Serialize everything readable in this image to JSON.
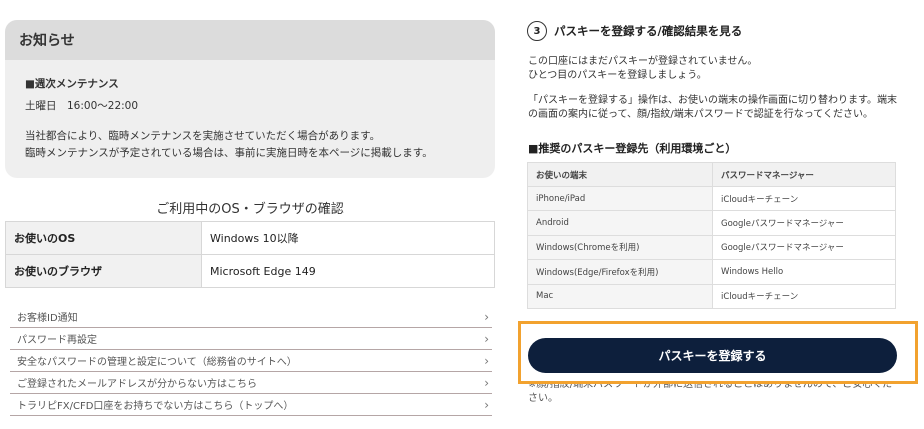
{
  "notice": {
    "heading": "お知らせ",
    "title": "■週次メンテナンス",
    "time": "土曜日　16:00～22:00",
    "line1": "当社都合により、臨時メンテナンスを実施させていただく場合があります。",
    "line2": "臨時メンテナンスが予定されている場合は、事前に実施日時を本ページに掲載します。"
  },
  "environment": {
    "title": "ご利用中のOS・ブラウザの確認",
    "rows": [
      {
        "label": "お使いのOS",
        "value": "Windows 10以降"
      },
      {
        "label": "お使いのブラウザ",
        "value": "Microsoft Edge 149"
      }
    ]
  },
  "links": [
    {
      "label": "お客様ID通知",
      "chevron": "›"
    },
    {
      "label": "パスワード再設定",
      "chevron": "›"
    },
    {
      "label": "安全なパスワードの管理と設定について（総務省のサイトへ）",
      "chevron": "›"
    },
    {
      "label": "ご登録されたメールアドレスが分からない方はこちら",
      "chevron": "›"
    },
    {
      "label": "トラリピFX/CFD口座をお持ちでない方はこちら（トップへ）",
      "chevron": "›"
    }
  ],
  "step": {
    "number": "3",
    "title": "パスキーを登録する/確認結果を見る"
  },
  "paragraphs": {
    "p1_line1": "この口座にはまだパスキーが登録されていません。",
    "p1_line2": "ひとつ目のパスキーを登録しましょう。",
    "p2": "「パスキーを登録する」操作は、お使いの端末の操作画面に切り替わります。端末の画面の案内に従って、顔/指紋/端末パスワードで認証を行なってください。"
  },
  "recommended": {
    "title": "■推奨のパスキー登録先（利用環境ごと）",
    "headers": [
      "お使いの端末",
      "パスワードマネージャー"
    ],
    "rows": [
      [
        "iPhone/iPad",
        "iCloudキーチェーン"
      ],
      [
        "Android",
        "Googleパスワードマネージャー"
      ],
      [
        "Windows(Chromeを利用)",
        "Googleパスワードマネージャー"
      ],
      [
        "Windows(Edge/Firefoxを利用)",
        "Windows Hello"
      ],
      [
        "Mac",
        "iCloudキーチェーン"
      ]
    ]
  },
  "register_button": "パスキーを登録する",
  "note": "※顔/指紋/端末パスワードが外部に送信されることはありませんので、ご安心ください。",
  "colors": {
    "button_bg": "#0d1f3c",
    "highlight": "#f2a22f"
  }
}
